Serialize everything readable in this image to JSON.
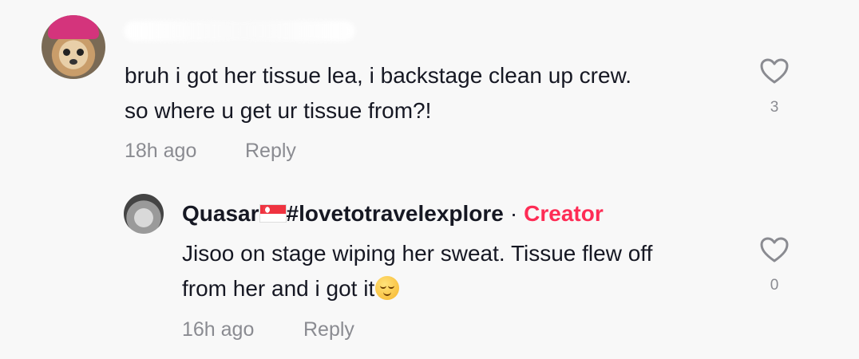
{
  "comment": {
    "lines": [
      "bruh i got her tissue lea, i backstage clean up crew.",
      "so where u get ur tissue from?!"
    ],
    "timestamp": "18h ago",
    "reply_label": "Reply",
    "like_count": "3",
    "like_icon": "heart-outline-icon"
  },
  "reply": {
    "username": "Quasar",
    "flag_icon": "singapore-flag-icon",
    "username_tag": "#lovetotravelexplore",
    "separator": "·",
    "badge": "Creator",
    "lines": [
      "Jisoo on stage wiping her sweat. Tissue flew off",
      "from her and i got it"
    ],
    "emoji": "relieved-face-emoji",
    "timestamp": "16h ago",
    "reply_label": "Reply",
    "like_count": "0",
    "like_icon": "heart-outline-icon"
  },
  "colors": {
    "background": "#f8f8f8",
    "text": "#161823",
    "muted": "#8a8b91",
    "creator": "#fe2c55"
  }
}
